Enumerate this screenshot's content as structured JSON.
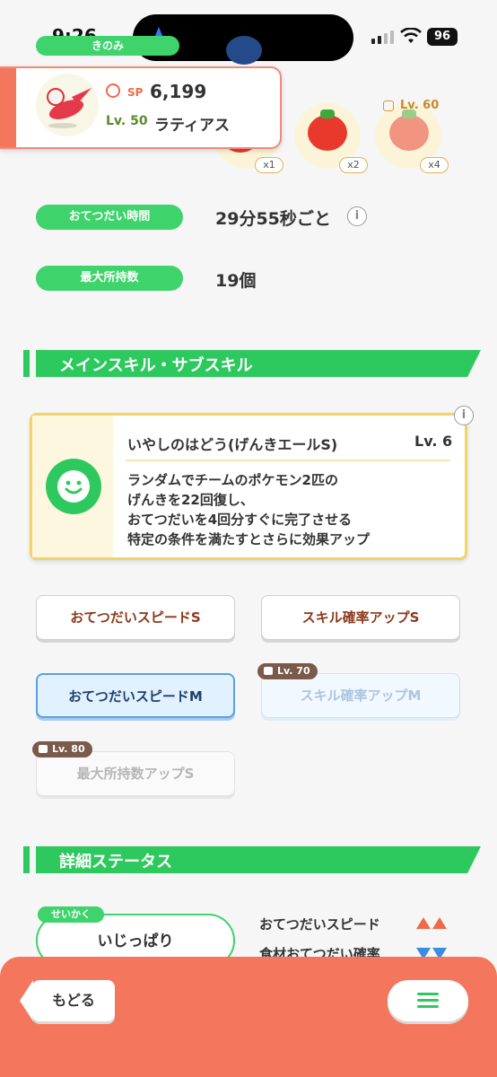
{
  "status_bar": {
    "time": "9:26",
    "battery": "96"
  },
  "berry_section": {
    "label": "きのみ"
  },
  "pokemon": {
    "sp_label": "SP",
    "sp_value": "6,199",
    "level": "Lv. 50",
    "name": "ラティアス"
  },
  "berries": [
    {
      "qty": "x1"
    },
    {
      "qty": "x2"
    },
    {
      "qty": "x4",
      "unlock_level": "Lv. 60"
    }
  ],
  "help_time": {
    "label": "おてつだい時間",
    "value": "29分55秒ごと",
    "info": "i"
  },
  "max_carry": {
    "label": "最大所持数",
    "value": "19個"
  },
  "skill_section": {
    "title": "メインスキル・サブスキル"
  },
  "main_skill": {
    "name": "いやしのはどう(げんきエールS)",
    "level": "Lv. 6",
    "info": "i",
    "description": "ランダムでチームのポケモン2匹の\nげんきを22回復し、\nおてつだいを4回分すぐに完了させる\n特定の条件を満たすとさらに効果アップ"
  },
  "sub_skills": [
    {
      "label": "おてつだいスピードS"
    },
    {
      "label": "スキル確率アップS"
    },
    {
      "label": "おてつだいスピードM"
    },
    {
      "label": "スキル確率アップM",
      "lock": "Lv. 70"
    },
    {
      "label": "最大所持数アップS",
      "lock": "Lv. 80"
    }
  ],
  "detail_section": {
    "title": "詳細ステータス"
  },
  "nature": {
    "tag": "せいかく",
    "value": "いじっぱり",
    "effects": [
      {
        "label": "おてつだいスピード",
        "direction": "up"
      },
      {
        "label": "食材おてつだい確率",
        "direction": "down"
      }
    ]
  },
  "footer": {
    "back_label": "もどる"
  },
  "colors": {
    "accent_green": "#2ec95e",
    "footer_orange": "#f4775d",
    "card_border": "#f2d36a"
  }
}
